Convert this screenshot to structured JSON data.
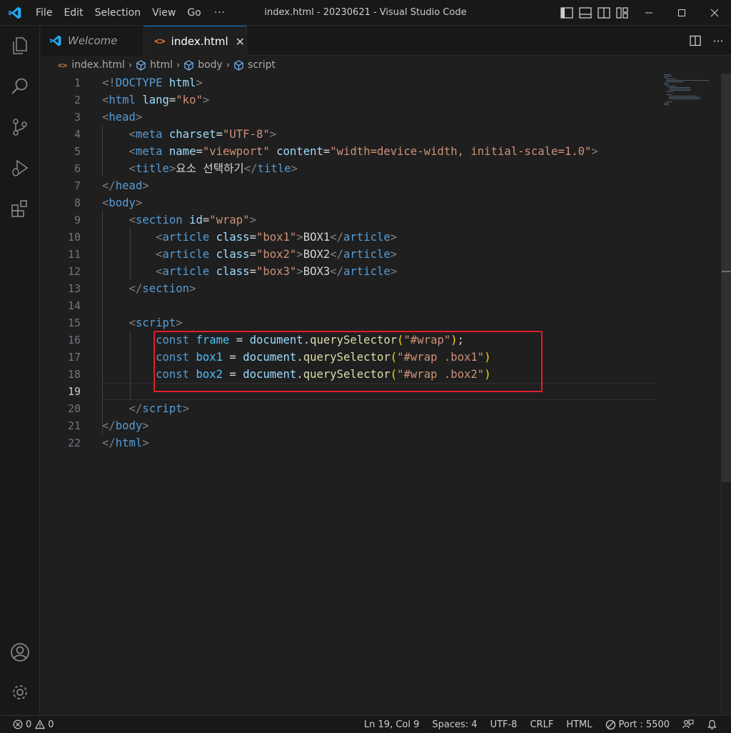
{
  "window": {
    "title": "index.html - 20230621 - Visual Studio Code",
    "accent_color": "#0078d4"
  },
  "menubar": {
    "items": [
      "File",
      "Edit",
      "Selection",
      "View",
      "Go"
    ],
    "more": "···"
  },
  "tabs": [
    {
      "label": "Welcome",
      "icon": "vscode-logo-icon",
      "active": false
    },
    {
      "label": "index.html",
      "icon": "html-file-icon",
      "active": true,
      "close": "✕"
    }
  ],
  "breadcrumb": {
    "file": "index.html",
    "items": [
      "html",
      "body",
      "script"
    ]
  },
  "editor": {
    "line_numbers": [
      "1",
      "2",
      "3",
      "4",
      "5",
      "6",
      "7",
      "8",
      "9",
      "10",
      "11",
      "12",
      "13",
      "14",
      "15",
      "16",
      "17",
      "18",
      "19",
      "20",
      "21",
      "22"
    ],
    "current_line": "19",
    "lines": {
      "l1": {
        "a": "<!",
        "b": "DOCTYPE",
        "c": "html",
        "d": ">"
      },
      "l2": {
        "a": "<",
        "tag": "html",
        "attr": "lang",
        "eq": "=",
        "val": "\"ko\"",
        "z": ">"
      },
      "l3": {
        "a": "<",
        "tag": "head",
        "z": ">"
      },
      "l4": {
        "a": "<",
        "tag": "meta",
        "attr": "charset",
        "eq": "=",
        "val": "\"UTF-8\"",
        "z": ">"
      },
      "l5": {
        "a": "<",
        "tag": "meta",
        "attr": "name",
        "eq": "=",
        "val": "\"viewport\"",
        "attr2": "content",
        "eq2": "=",
        "val2": "\"width=device-width, initial-scale=1.0\"",
        "z": ">"
      },
      "l6": {
        "a": "<",
        "tag": "title",
        "z": ">",
        "text": "요소 선택하기",
        "a2": "</",
        "tag2": "title",
        "z2": ">"
      },
      "l7": {
        "a": "</",
        "tag": "head",
        "z": ">"
      },
      "l8": {
        "a": "<",
        "tag": "body",
        "z": ">"
      },
      "l9": {
        "a": "<",
        "tag": "section",
        "attr": "id",
        "eq": "=",
        "val": "\"wrap\"",
        "z": ">"
      },
      "l10": {
        "a": "<",
        "tag": "article",
        "attr": "class",
        "eq": "=",
        "val": "\"box1\"",
        "z": ">",
        "text": "BOX1",
        "a2": "</",
        "tag2": "article",
        "z2": ">"
      },
      "l11": {
        "a": "<",
        "tag": "article",
        "attr": "class",
        "eq": "=",
        "val": "\"box2\"",
        "z": ">",
        "text": "BOX2",
        "a2": "</",
        "tag2": "article",
        "z2": ">"
      },
      "l12": {
        "a": "<",
        "tag": "article",
        "attr": "class",
        "eq": "=",
        "val": "\"box3\"",
        "z": ">",
        "text": "BOX3",
        "a2": "</",
        "tag2": "article",
        "z2": ">"
      },
      "l13": {
        "a": "</",
        "tag": "section",
        "z": ">"
      },
      "l15": {
        "a": "<",
        "tag": "script",
        "z": ">"
      },
      "l16": {
        "kw": "const",
        "var": "frame",
        "op": " = ",
        "obj": "document",
        "dot": ".",
        "fn": "querySelector",
        "p1": "(",
        "str": "\"#wrap\"",
        "p2": ")",
        "end": ";"
      },
      "l17": {
        "kw": "const",
        "var": "box1",
        "op": " = ",
        "obj": "document",
        "dot": ".",
        "fn": "querySelector",
        "p1": "(",
        "str": "\"#wrap .box1\"",
        "p2": ")"
      },
      "l18": {
        "kw": "const",
        "var": "box2",
        "op": " = ",
        "obj": "document",
        "dot": ".",
        "fn": "querySelector",
        "p1": "(",
        "str": "\"#wrap .box2\"",
        "p2": ")"
      },
      "l20": {
        "a": "</",
        "tag": "script",
        "z": ">"
      },
      "l21": {
        "a": "</",
        "tag": "body",
        "z": ">"
      },
      "l22": {
        "a": "</",
        "tag": "html",
        "z": ">"
      }
    },
    "highlight_color": "#e11d2a"
  },
  "statusbar": {
    "errors": "0",
    "warnings": "0",
    "cursor": "Ln 19, Col 9",
    "spaces": "Spaces: 4",
    "encoding": "UTF-8",
    "eol": "CRLF",
    "language": "HTML",
    "port": "Port : 5500"
  }
}
